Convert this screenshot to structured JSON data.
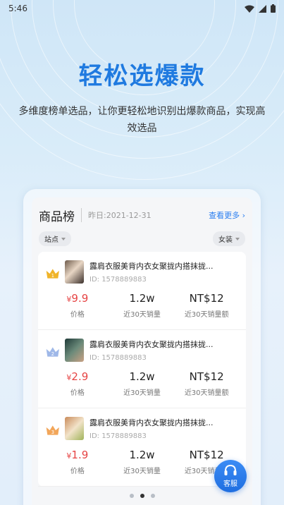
{
  "status_bar": {
    "time": "5:46"
  },
  "hero": {
    "title": "轻松选爆款",
    "subtitle": "多维度榜单选品，让你更轻松地识别出爆款商品，实现高效选品"
  },
  "panel": {
    "title": "商品榜",
    "date": "昨日:2021-12-31",
    "more": "查看更多",
    "filters": {
      "left": "站点",
      "right": "女装"
    }
  },
  "items": [
    {
      "rank": "1",
      "title": "露肩衣服美背内衣女聚拢内搭抹拢...",
      "id": "ID:  1578889883",
      "currency": "¥",
      "price": "9.9",
      "price_label": "价格",
      "sales": "1.2w",
      "sales_label": "近30天销量",
      "amount": "NT$12",
      "amount_label": "近30天销量额",
      "rank_color": "#f0b429"
    },
    {
      "rank": "2",
      "title": "露肩衣服美背内衣女聚拢内搭抹拢...",
      "id": "ID:  1578889883",
      "currency": "¥",
      "price": "2.9",
      "price_label": "价格",
      "sales": "1.2w",
      "sales_label": "近30天销量",
      "amount": "NT$12",
      "amount_label": "近30天销量额",
      "rank_color": "#9fb8e8"
    },
    {
      "rank": "3",
      "title": "露肩衣服美背内衣女聚拢内搭抹拢...",
      "id": "ID:  1578889883",
      "currency": "¥",
      "price": "1.9",
      "price_label": "价格",
      "sales": "1.2w",
      "sales_label": "近30天销量",
      "amount": "NT$12",
      "amount_label": "近30天销量额",
      "rank_color": "#f2a65a"
    }
  ],
  "pager": {
    "count": 3,
    "active": 1
  },
  "service": {
    "label": "客服"
  }
}
